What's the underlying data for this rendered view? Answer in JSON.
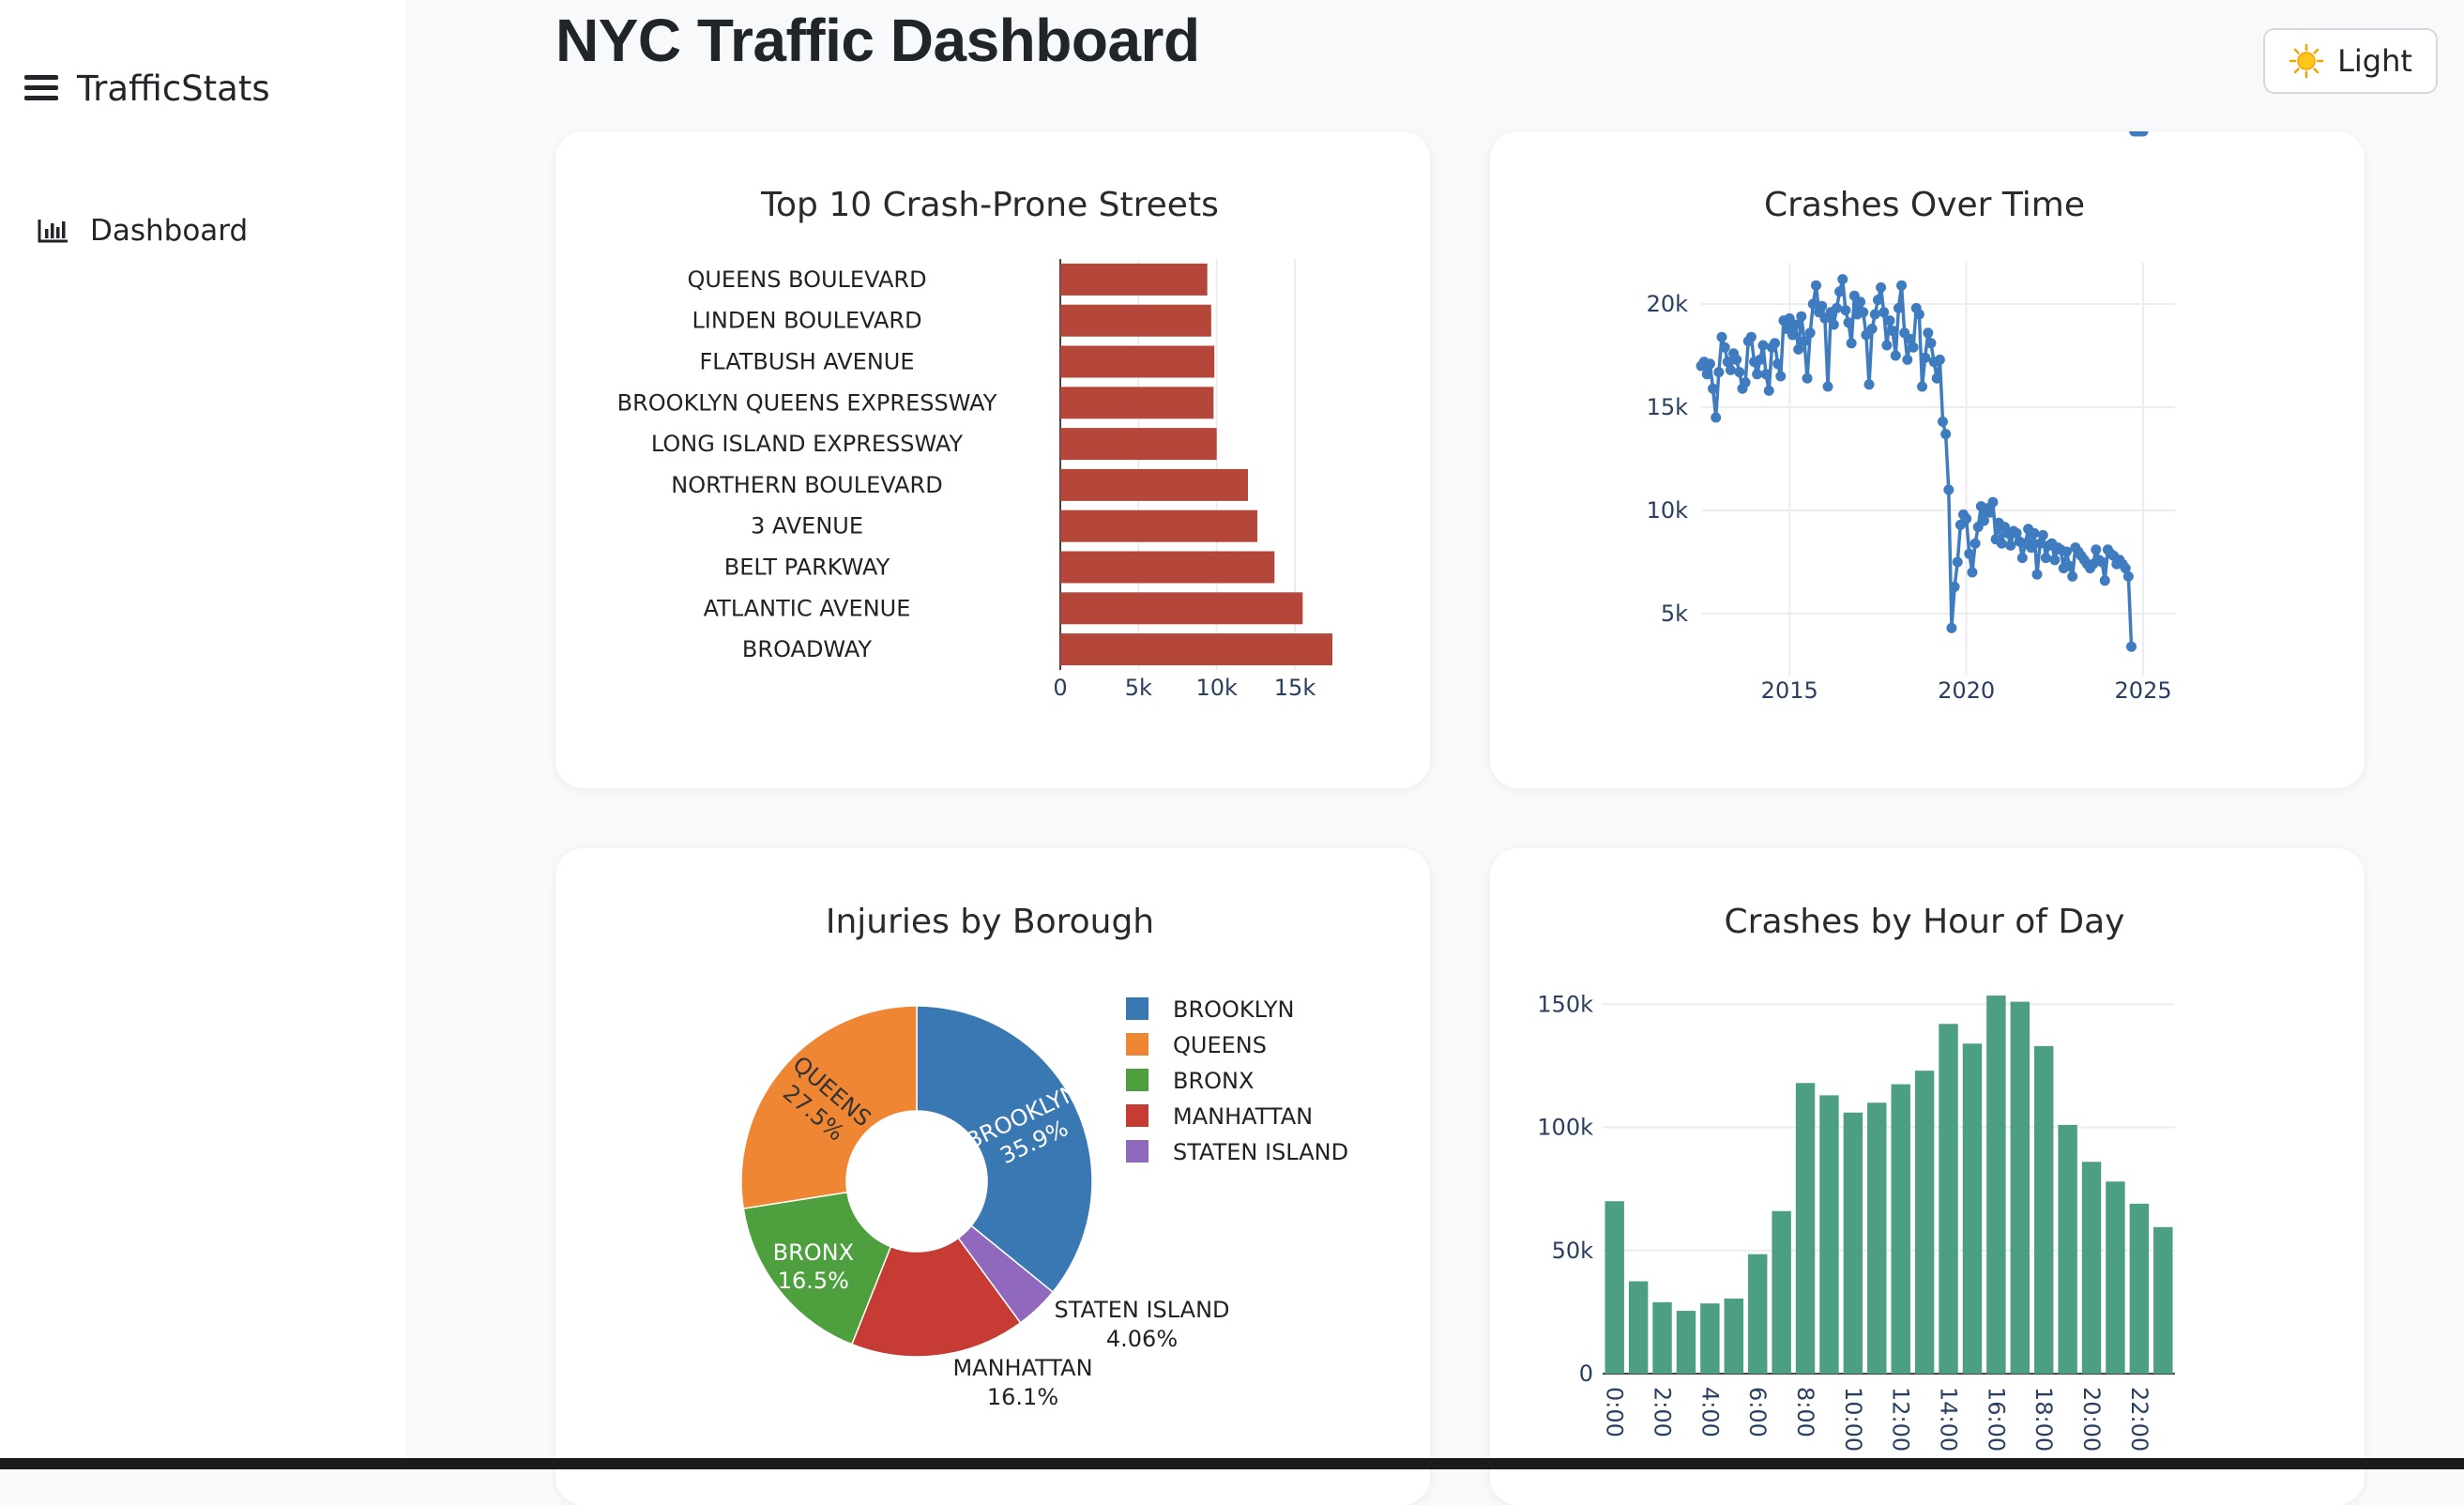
{
  "app": {
    "brand": "TrafficStats"
  },
  "sidebar": {
    "items": [
      {
        "label": "Dashboard",
        "icon": "bar-chart-icon"
      }
    ]
  },
  "header": {
    "title": "NYC Traffic Dashboard",
    "theme_button": {
      "label": "Light",
      "icon": "sun-icon"
    }
  },
  "colors": {
    "bar": "#b5473a",
    "line": "#3f7cbf",
    "hour": "#4c9f83"
  },
  "chart_data": [
    {
      "id": "streets",
      "type": "bar",
      "orientation": "horizontal",
      "title": "Top 10 Crash-Prone Streets",
      "categories": [
        "QUEENS BOULEVARD",
        "LINDEN BOULEVARD",
        "FLATBUSH AVENUE",
        "BROOKLYN QUEENS EXPRESSWAY",
        "LONG ISLAND EXPRESSWAY",
        "NORTHERN BOULEVARD",
        "3 AVENUE",
        "BELT PARKWAY",
        "ATLANTIC AVENUE",
        "BROADWAY"
      ],
      "values": [
        9400,
        9650,
        9850,
        9800,
        10000,
        12000,
        12600,
        13700,
        15500,
        17400
      ],
      "xlim": [
        0,
        18000
      ],
      "x_ticks": [
        0,
        5000,
        10000,
        15000
      ],
      "x_tick_labels": [
        "0",
        "5k",
        "10k",
        "15k"
      ],
      "grid": true
    },
    {
      "id": "time",
      "type": "line",
      "title": "Crashes Over Time",
      "x_ticks": [
        2015,
        2020,
        2025
      ],
      "x_tick_labels": [
        "2015",
        "2020",
        "2025"
      ],
      "y_ticks": [
        5000,
        10000,
        15000,
        20000
      ],
      "y_tick_labels": [
        "5k",
        "10k",
        "15k",
        "20k"
      ],
      "xlim": [
        2012.5,
        2025.9
      ],
      "ylim": [
        2000,
        22000
      ],
      "grid": true,
      "x": [
        "2012-07",
        "2012-08",
        "2012-09",
        "2012-10",
        "2012-11",
        "2012-12",
        "2013-01",
        "2013-02",
        "2013-03",
        "2013-04",
        "2013-05",
        "2013-06",
        "2013-07",
        "2013-08",
        "2013-09",
        "2013-10",
        "2013-11",
        "2013-12",
        "2014-01",
        "2014-02",
        "2014-03",
        "2014-04",
        "2014-05",
        "2014-06",
        "2014-07",
        "2014-08",
        "2014-09",
        "2014-10",
        "2014-11",
        "2014-12",
        "2015-01",
        "2015-02",
        "2015-03",
        "2015-04",
        "2015-05",
        "2015-06",
        "2015-07",
        "2015-08",
        "2015-09",
        "2015-10",
        "2015-11",
        "2015-12",
        "2016-01",
        "2016-02",
        "2016-03",
        "2016-04",
        "2016-05",
        "2016-06",
        "2016-07",
        "2016-08",
        "2016-09",
        "2016-10",
        "2016-11",
        "2016-12",
        "2017-01",
        "2017-02",
        "2017-03",
        "2017-04",
        "2017-05",
        "2017-06",
        "2017-07",
        "2017-08",
        "2017-09",
        "2017-10",
        "2017-11",
        "2017-12",
        "2018-01",
        "2018-02",
        "2018-03",
        "2018-04",
        "2018-05",
        "2018-06",
        "2018-07",
        "2018-08",
        "2018-09",
        "2018-10",
        "2018-11",
        "2018-12",
        "2019-01",
        "2019-02",
        "2019-03",
        "2019-04",
        "2019-05",
        "2019-06",
        "2019-07",
        "2019-08",
        "2019-09",
        "2019-10",
        "2019-11",
        "2019-12",
        "2020-01",
        "2020-02",
        "2020-03",
        "2020-04",
        "2020-05",
        "2020-06",
        "2020-07",
        "2020-08",
        "2020-09",
        "2020-10",
        "2020-11",
        "2020-12",
        "2021-01",
        "2021-02",
        "2021-03",
        "2021-04",
        "2021-05",
        "2021-06",
        "2021-07",
        "2021-08",
        "2021-09",
        "2021-10",
        "2021-11",
        "2021-12",
        "2022-01",
        "2022-02",
        "2022-03",
        "2022-04",
        "2022-05",
        "2022-06",
        "2022-07",
        "2022-08",
        "2022-09",
        "2022-10",
        "2022-11",
        "2022-12",
        "2023-01",
        "2023-02",
        "2023-03",
        "2023-04",
        "2023-05",
        "2023-06",
        "2023-07",
        "2023-08",
        "2023-09",
        "2023-10",
        "2023-11",
        "2023-12",
        "2024-01",
        "2024-02",
        "2024-03",
        "2024-04",
        "2024-05",
        "2024-06",
        "2024-07",
        "2024-08",
        "2024-09",
        "2024-10",
        "2024-11",
        "2024-12",
        "2025-01"
      ],
      "values": [
        17000,
        17200,
        16600,
        17100,
        15900,
        14500,
        16700,
        18400,
        17900,
        17200,
        16800,
        17600,
        17300,
        16700,
        15900,
        16200,
        18200,
        18400,
        17200,
        16600,
        17300,
        18000,
        16600,
        15800,
        17900,
        18100,
        17100,
        16500,
        19200,
        18800,
        19300,
        18500,
        19000,
        17800,
        19400,
        18200,
        16400,
        18600,
        20000,
        20900,
        19600,
        19900,
        19300,
        16000,
        19600,
        19000,
        19800,
        20600,
        21200,
        19700,
        19100,
        18100,
        20400,
        19500,
        20100,
        19600,
        18500,
        16100,
        18800,
        19500,
        20200,
        20800,
        19600,
        18000,
        19200,
        18700,
        17500,
        19800,
        20900,
        18600,
        17300,
        18300,
        17900,
        19800,
        19500,
        16000,
        17400,
        18600,
        18100,
        17200,
        16400,
        17300,
        14300,
        13700,
        11000,
        4300,
        6300,
        7500,
        9300,
        9800,
        9600,
        7900,
        7000,
        8400,
        9200,
        10200,
        9500,
        10100,
        9900,
        10400,
        8600,
        9400,
        8400,
        9200,
        8900,
        8300,
        9000,
        8900,
        8500,
        7700,
        8400,
        9100,
        8200,
        8900,
        6900,
        8400,
        8800,
        7700,
        8300,
        8400,
        7600,
        8200,
        8100,
        7200,
        8000,
        7300,
        6800,
        8200,
        8000,
        7800,
        7600,
        7400,
        7200,
        7400,
        8100,
        7600,
        7500,
        6600,
        8100,
        7900,
        7800,
        7400,
        7600,
        7400,
        7200,
        6800,
        3400
      ]
    },
    {
      "id": "borough",
      "type": "pie",
      "title": "Injuries by Borough",
      "labels": [
        "BROOKLYN",
        "QUEENS",
        "BRONX",
        "MANHATTAN",
        "STATEN ISLAND"
      ],
      "values": [
        35.9,
        27.5,
        16.5,
        16.1,
        4.06
      ],
      "slice_order": [
        "BROOKLYN",
        "STATEN ISLAND",
        "MANHATTAN",
        "BRONX",
        "QUEENS"
      ],
      "percent_labels": {
        "BROOKLYN": "35.9%",
        "QUEENS": "27.5%",
        "BRONX": "16.5%",
        "MANHATTAN": "16.1%",
        "STATEN ISLAND": "4.06%"
      },
      "colors": {
        "BROOKLYN": "#3a78b3",
        "QUEENS": "#ef8633",
        "BRONX": "#4e9f3d",
        "MANHATTAN": "#c63b33",
        "STATEN ISLAND": "#9068bd"
      },
      "legend": "right"
    },
    {
      "id": "hour",
      "type": "bar",
      "title": "Crashes by Hour of Day",
      "categories": [
        "0:00",
        "1:00",
        "2:00",
        "3:00",
        "4:00",
        "5:00",
        "6:00",
        "7:00",
        "8:00",
        "9:00",
        "10:00",
        "11:00",
        "12:00",
        "13:00",
        "14:00",
        "15:00",
        "16:00",
        "17:00",
        "18:00",
        "19:00",
        "20:00",
        "21:00",
        "22:00",
        "23:00"
      ],
      "x_tick_labels": [
        "0:00",
        "2:00",
        "4:00",
        "6:00",
        "8:00",
        "10:00",
        "12:00",
        "14:00",
        "16:00",
        "18:00",
        "20:00",
        "22:00"
      ],
      "values": [
        70000,
        37500,
        29000,
        25500,
        28500,
        30500,
        48500,
        66000,
        118000,
        113000,
        106000,
        110000,
        117500,
        123000,
        142000,
        134000,
        153500,
        151000,
        133000,
        101000,
        86000,
        78000,
        69000,
        59500
      ],
      "y_ticks": [
        0,
        50000,
        100000,
        150000
      ],
      "y_tick_labels": [
        "0",
        "50k",
        "100k",
        "150k"
      ],
      "ylim": [
        0,
        160000
      ],
      "grid": true
    }
  ]
}
